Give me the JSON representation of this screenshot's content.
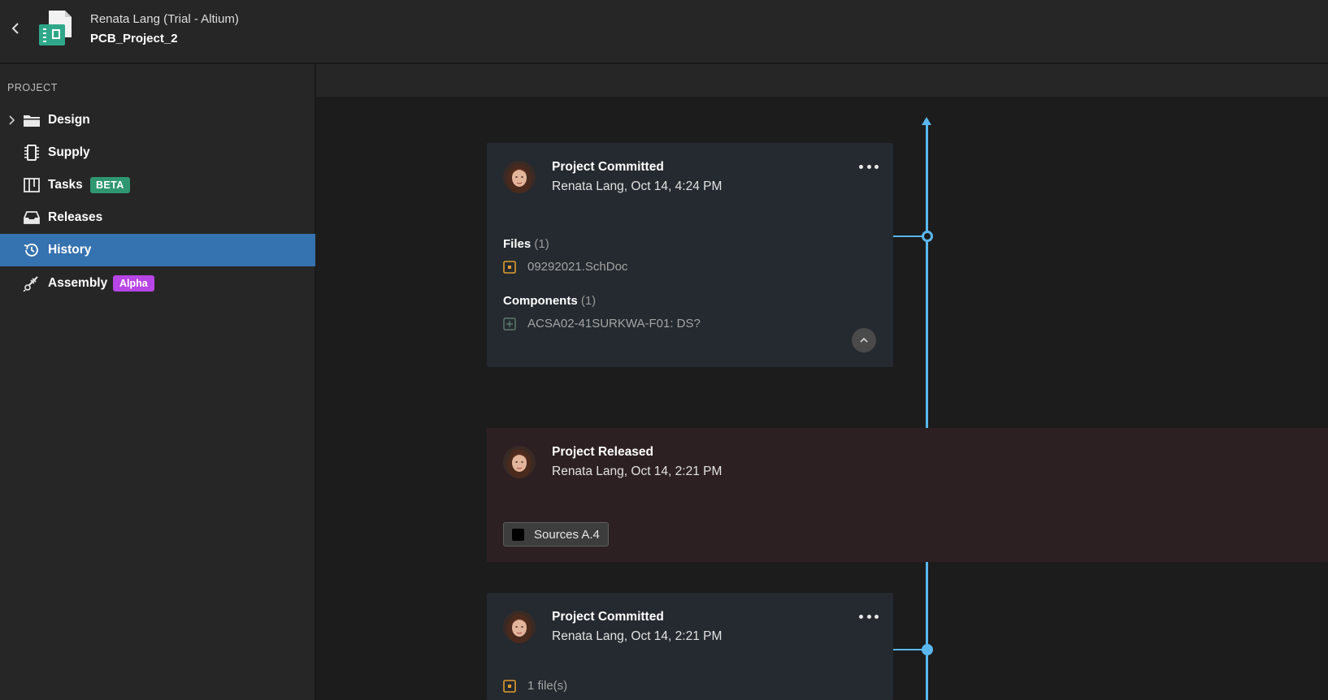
{
  "header": {
    "owner": "Renata Lang (Trial - Altium)",
    "project_name": "PCB_Project_2"
  },
  "sidebar": {
    "section_label": "PROJECT",
    "items": [
      {
        "label": "Design",
        "icon": "folder-icon"
      },
      {
        "label": "Supply",
        "icon": "chip-icon"
      },
      {
        "label": "Tasks",
        "icon": "board-icon",
        "badge": "BETA"
      },
      {
        "label": "Releases",
        "icon": "inbox-icon"
      },
      {
        "label": "History",
        "icon": "history-icon",
        "active": true
      },
      {
        "label": "Assembly",
        "icon": "assembly-icon",
        "badge": "Alpha"
      }
    ]
  },
  "timeline": [
    {
      "type": "commit",
      "title": "Project Committed",
      "subtitle": "Renata Lang, Oct 14, 4:24 PM",
      "files_label": "Files",
      "files_count": "(1)",
      "files": [
        "09292021.SchDoc"
      ],
      "components_label": "Components",
      "components_count": "(1)",
      "components": [
        "ACSA02-41SURKWA-F01: DS?"
      ]
    },
    {
      "type": "release",
      "title": "Project Released",
      "subtitle": "Renata Lang, Oct 14, 2:21 PM",
      "tag": "Sources A.4"
    },
    {
      "type": "commit",
      "title": "Project Committed",
      "subtitle": "Renata Lang, Oct 14, 2:21 PM",
      "file_summary": "1 file(s)"
    }
  ],
  "colors": {
    "timeline": "#5ab7ee",
    "active_nav": "#3572b0",
    "beta_badge": "#2f9770",
    "alpha_badge": "#b845e6",
    "file_icon": "#e09a2e"
  }
}
